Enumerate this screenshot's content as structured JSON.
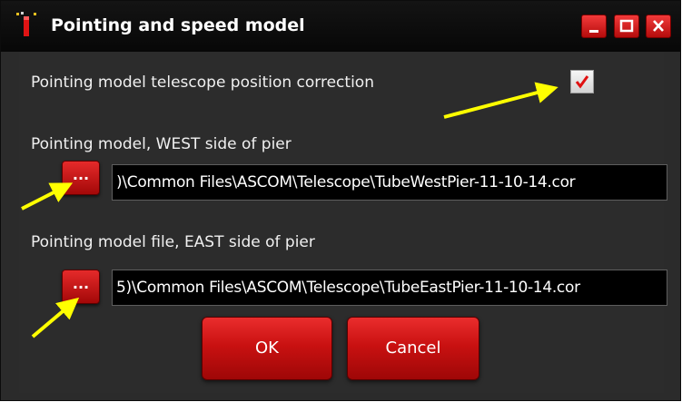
{
  "window": {
    "title": "Pointing and speed model",
    "controls": [
      {
        "name": "minimize",
        "icon": "minimize-icon"
      },
      {
        "name": "maximize",
        "icon": "maximize-icon"
      },
      {
        "name": "close",
        "icon": "close-icon"
      }
    ]
  },
  "correction": {
    "label": "Pointing model telescope position correction",
    "checked": true,
    "icon": "checkmark-icon"
  },
  "west": {
    "label": "Pointing model, WEST side of pier",
    "browse_label": "...",
    "path_value": ")\\Common Files\\ASCOM\\Telescope\\TubeWestPier-11-10-14.cor"
  },
  "east": {
    "label": "Pointing model file, EAST side of pier",
    "browse_label": "...",
    "path_value": "5)\\Common Files\\ASCOM\\Telescope\\TubeEastPier-11-10-14.cor"
  },
  "buttons": {
    "ok_label": "OK",
    "cancel_label": "Cancel"
  },
  "colors": {
    "accent": "#d81414",
    "background": "#2c2c2c",
    "field": "#000000",
    "annotation_arrow": "#ffff00",
    "check": "#e01010"
  },
  "annotations": {
    "icon": "yellow-arrow-annotation"
  }
}
